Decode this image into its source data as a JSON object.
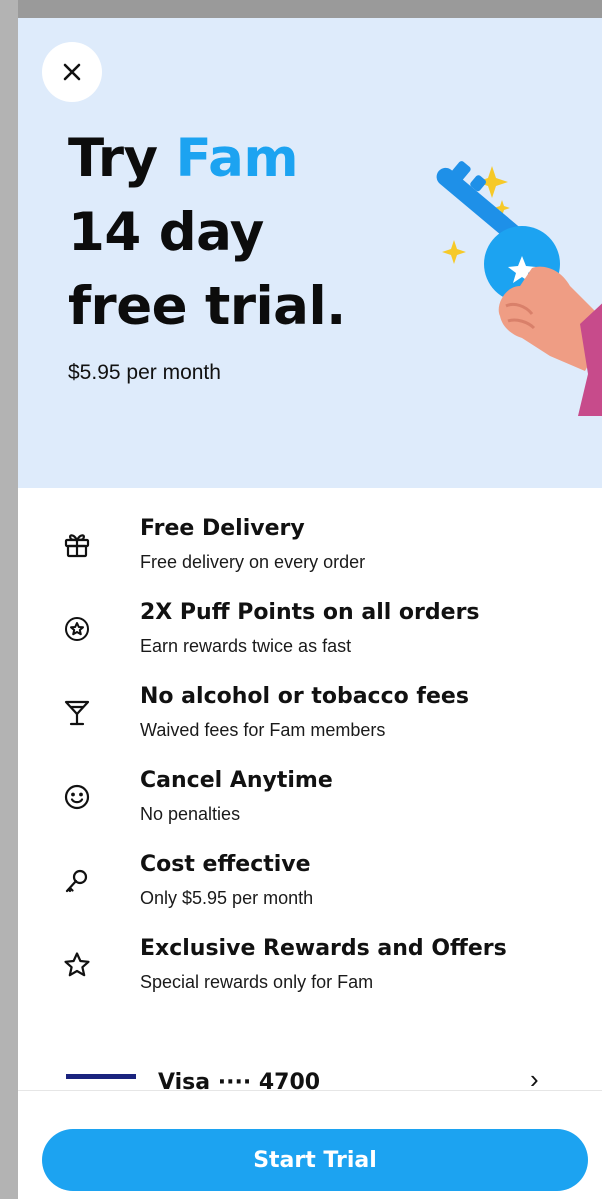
{
  "hero": {
    "title_prefix": "Try ",
    "title_brand": "Fam",
    "title_line2": "14 day",
    "title_line3": "free trial.",
    "price_text": "$5.95 per month",
    "background_color": "#deebfb",
    "accent_color": "#1ca3f1"
  },
  "close_button": {
    "icon": "close-icon"
  },
  "benefits": [
    {
      "icon": "gift-icon",
      "title": "Free Delivery",
      "subtitle": "Free delivery on every order"
    },
    {
      "icon": "star-badge-icon",
      "title": "2X Puff Points on all orders",
      "subtitle": "Earn rewards twice as fast"
    },
    {
      "icon": "cocktail-glass-icon",
      "title": "No alcohol or tobacco fees",
      "subtitle": "Waived fees for Fam members"
    },
    {
      "icon": "smiley-icon",
      "title": "Cancel Anytime",
      "subtitle": "No penalties"
    },
    {
      "icon": "key-icon",
      "title": "Cost effective",
      "subtitle": "Only $5.95 per month"
    },
    {
      "icon": "star-outline-icon",
      "title": "Exclusive Rewards and Offers",
      "subtitle": "Special rewards only for Fam"
    }
  ],
  "payment": {
    "card_icon": "visa-card-icon",
    "label": "Visa ···· 4700",
    "chevron_icon": "chevron-right-icon"
  },
  "footer": {
    "start_button_label": "Start Trial",
    "button_color": "#1ca3f1"
  }
}
